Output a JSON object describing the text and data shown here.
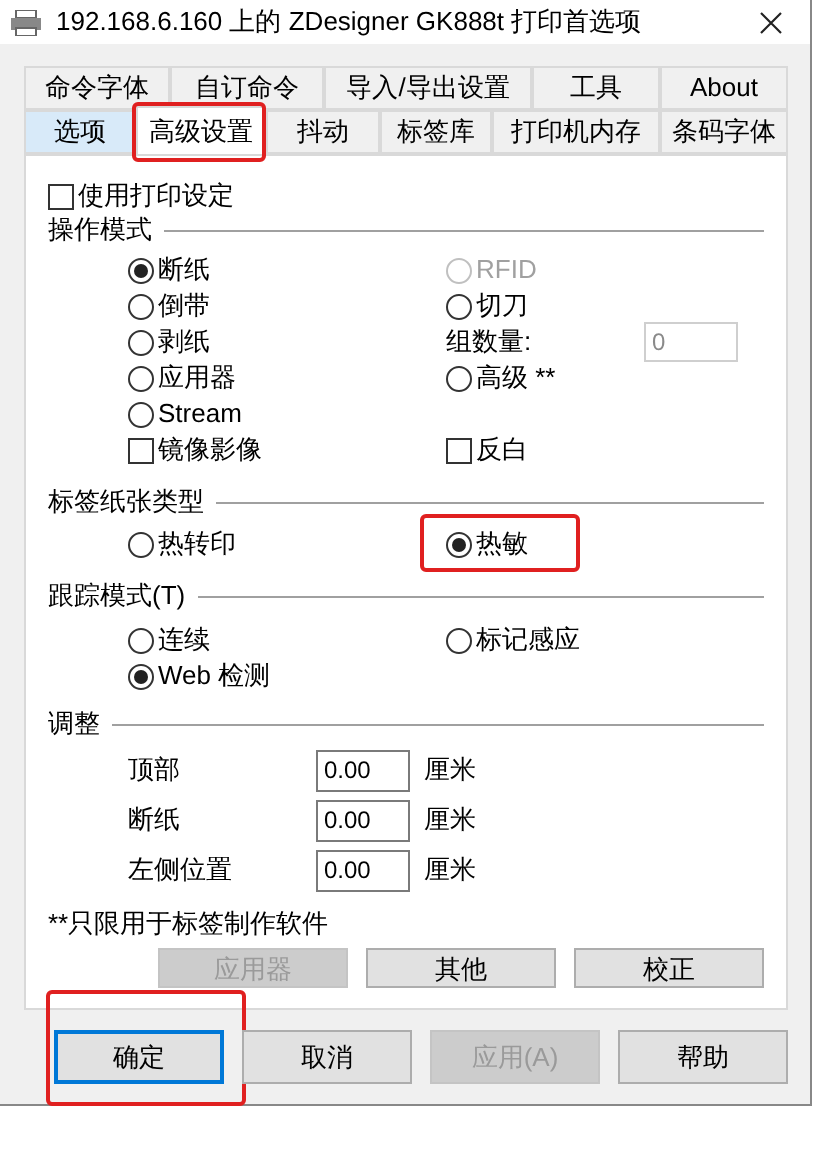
{
  "window": {
    "title": "192.168.6.160 上的 ZDesigner GK888t 打印首选项"
  },
  "tab_rows": [
    [
      {
        "label": "命令字体",
        "selected": false,
        "hovered": false,
        "highlighted": false
      },
      {
        "label": "自订命令",
        "selected": false,
        "hovered": false,
        "highlighted": false
      },
      {
        "label": "导入/导出设置",
        "selected": false,
        "hovered": false,
        "highlighted": false
      },
      {
        "label": "工具",
        "selected": false,
        "hovered": false,
        "highlighted": false
      },
      {
        "label": "About",
        "selected": false,
        "hovered": false,
        "highlighted": false
      }
    ],
    [
      {
        "label": "选项",
        "selected": false,
        "hovered": true,
        "highlighted": false
      },
      {
        "label": "高级设置",
        "selected": true,
        "hovered": false,
        "highlighted": true
      },
      {
        "label": "抖动",
        "selected": false,
        "hovered": false,
        "highlighted": false
      },
      {
        "label": "标签库",
        "selected": false,
        "hovered": false,
        "highlighted": false
      },
      {
        "label": "打印机内存",
        "selected": false,
        "hovered": false,
        "highlighted": false
      },
      {
        "label": "条码字体",
        "selected": false,
        "hovered": false,
        "highlighted": false
      }
    ]
  ],
  "use_printer_settings": {
    "label": "使用打印设定",
    "checked": false
  },
  "sections": [
    {
      "title": "操作模式",
      "rows": [
        [
          {
            "kind": "radio",
            "label": "断纸",
            "selected": true,
            "disabled": false,
            "highlighted": false
          },
          {
            "kind": "radio",
            "label": "RFID",
            "selected": false,
            "disabled": true,
            "highlighted": false
          }
        ],
        [
          {
            "kind": "radio",
            "label": "倒带",
            "selected": false,
            "disabled": false,
            "highlighted": false
          },
          {
            "kind": "radio",
            "label": "切刀",
            "selected": false,
            "disabled": false,
            "highlighted": false
          }
        ],
        [
          {
            "kind": "radio",
            "label": "剥纸",
            "selected": false,
            "disabled": false,
            "highlighted": false
          },
          {
            "kind": "count",
            "label": "组数量:",
            "value": "0",
            "disabled": true
          }
        ],
        [
          {
            "kind": "radio",
            "label": "应用器",
            "selected": false,
            "disabled": false,
            "highlighted": false
          },
          {
            "kind": "radio",
            "label": "高级 **",
            "selected": false,
            "disabled": false,
            "highlighted": false
          }
        ],
        [
          {
            "kind": "radio",
            "label": "Stream",
            "selected": false,
            "disabled": false,
            "highlighted": false
          }
        ],
        [
          {
            "kind": "checkbox",
            "label": "镜像影像",
            "checked": false
          },
          {
            "kind": "checkbox",
            "label": "反白",
            "checked": false
          }
        ]
      ]
    },
    {
      "title": "标签纸张类型",
      "rows": [
        [
          {
            "kind": "radio",
            "label": "热转印",
            "selected": false,
            "disabled": false,
            "highlighted": false
          },
          {
            "kind": "radio",
            "label": "热敏",
            "selected": true,
            "disabled": false,
            "highlighted": true
          }
        ]
      ]
    },
    {
      "title": "跟踪模式(T)",
      "rows": [
        [
          {
            "kind": "radio",
            "label": "连续",
            "selected": false,
            "disabled": false,
            "highlighted": false
          },
          {
            "kind": "radio",
            "label": "标记感应",
            "selected": false,
            "disabled": false,
            "highlighted": false
          }
        ],
        [
          {
            "kind": "radio",
            "label": "Web 检测",
            "selected": true,
            "disabled": false,
            "highlighted": false
          }
        ]
      ]
    }
  ],
  "adjust": {
    "title": "调整",
    "rows": [
      {
        "label": "顶部",
        "value": "0.00",
        "unit": "厘米"
      },
      {
        "label": "断纸",
        "value": "0.00",
        "unit": "厘米"
      },
      {
        "label": "左侧位置",
        "value": "0.00",
        "unit": "厘米"
      }
    ]
  },
  "note": "**只限用于标签制作软件",
  "panel_buttons": [
    {
      "label": "应用器",
      "disabled": true
    },
    {
      "label": "其他",
      "disabled": false
    },
    {
      "label": "校正",
      "disabled": false
    }
  ],
  "footer_buttons": [
    {
      "label": "确定",
      "default": true,
      "disabled": false,
      "highlighted": true
    },
    {
      "label": "取消",
      "default": false,
      "disabled": false,
      "highlighted": false
    },
    {
      "label": "应用(A)",
      "default": false,
      "disabled": true,
      "highlighted": false
    },
    {
      "label": "帮助",
      "default": false,
      "disabled": false,
      "highlighted": false
    }
  ]
}
